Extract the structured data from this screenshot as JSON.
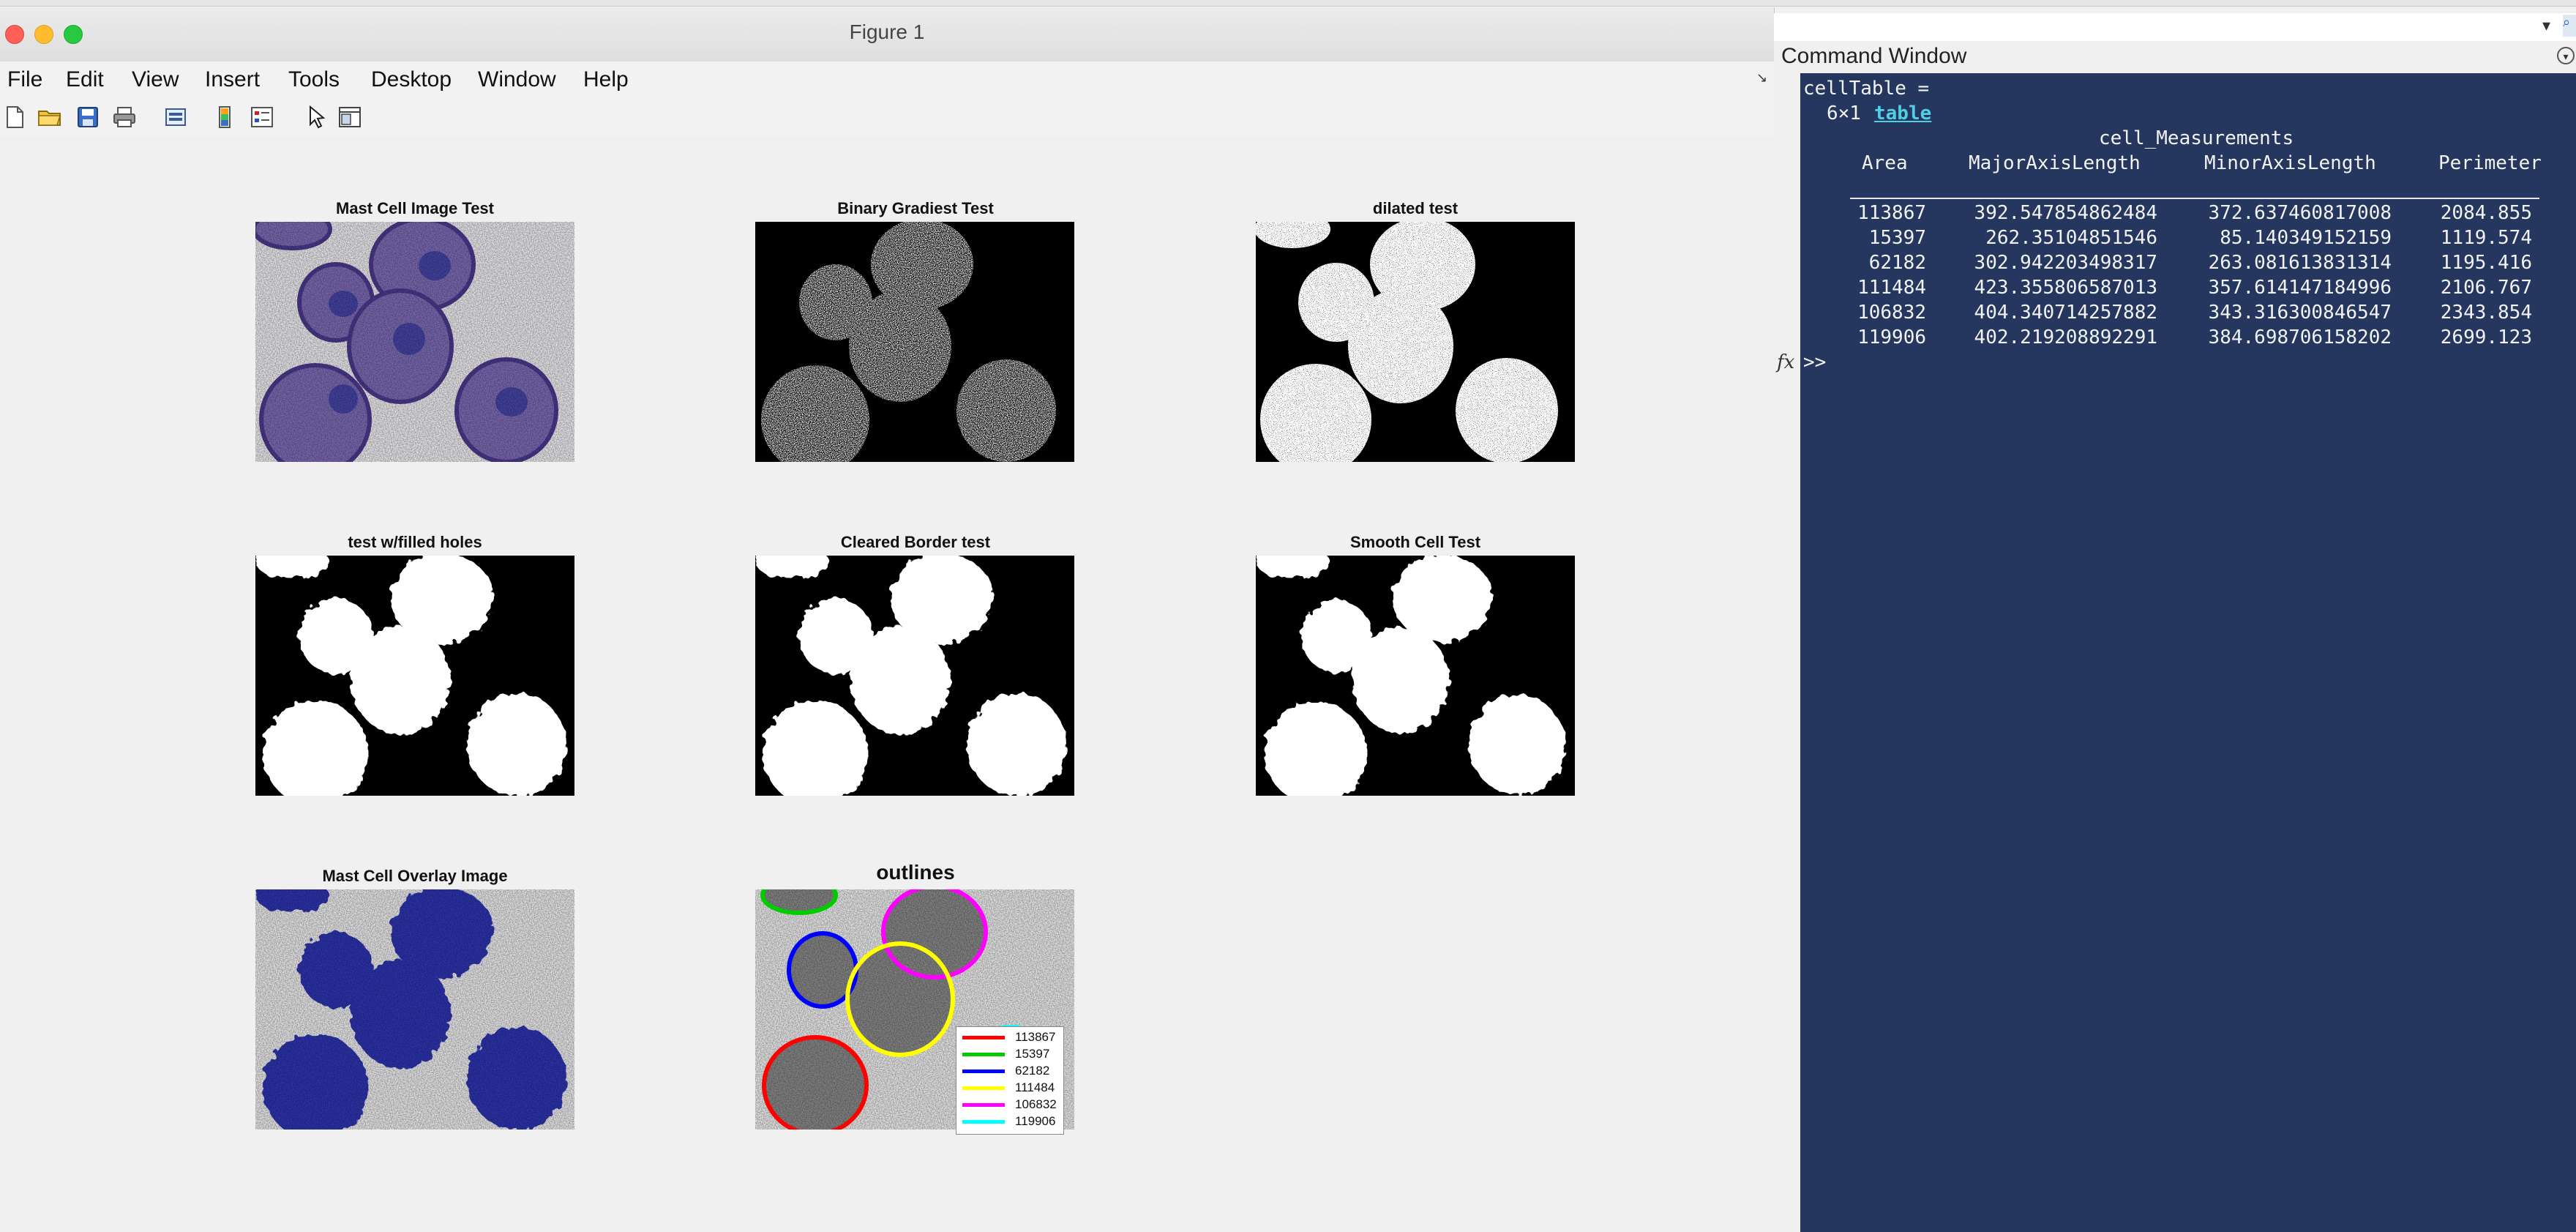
{
  "figure": {
    "title": "Figure 1",
    "menu": [
      "File",
      "Edit",
      "View",
      "Insert",
      "Tools",
      "Desktop",
      "Window",
      "Help"
    ],
    "panels": [
      {
        "title": "Mast Cell Image Test"
      },
      {
        "title": "Binary Gradiest Test"
      },
      {
        "title": "dilated test"
      },
      {
        "title": "test w/filled holes"
      },
      {
        "title": "Cleared Border test"
      },
      {
        "title": "Smooth Cell Test"
      },
      {
        "title": "Mast Cell Overlay Image"
      },
      {
        "title": "outlines"
      }
    ],
    "legend": [
      {
        "label": "113867",
        "color": "#ff0000"
      },
      {
        "label": "15397",
        "color": "#00cc00"
      },
      {
        "label": "62182",
        "color": "#0000ff"
      },
      {
        "label": "111484",
        "color": "#ffff00"
      },
      {
        "label": "106832",
        "color": "#ff00ff"
      },
      {
        "label": "119906",
        "color": "#00ffff"
      }
    ]
  },
  "command_window": {
    "title": "Command Window",
    "assign": "cellTable =",
    "size": "6×1",
    "type_link": "table",
    "var_name": "cell_Measurements",
    "columns": [
      "Area",
      "MajorAxisLength",
      "MinorAxisLength",
      "Perimeter"
    ],
    "rows": [
      [
        "113867",
        "392.547854862484",
        "372.637460817008",
        "2084.855"
      ],
      [
        "15397",
        "262.35104851546",
        "85.140349152159",
        "1119.574"
      ],
      [
        "62182",
        "302.942203498317",
        "263.081613831314",
        "1195.416"
      ],
      [
        "111484",
        "423.355806587013",
        "357.614147184996",
        "2106.767"
      ],
      [
        "106832",
        "404.340714257882",
        "343.316300846547",
        "2343.854"
      ],
      [
        "119906",
        "402.219208892291",
        "384.698706158202",
        "2699.123"
      ]
    ],
    "prompt": ">>"
  },
  "colors": {
    "command_bg": "#25375e",
    "link": "#4fd0e4"
  }
}
